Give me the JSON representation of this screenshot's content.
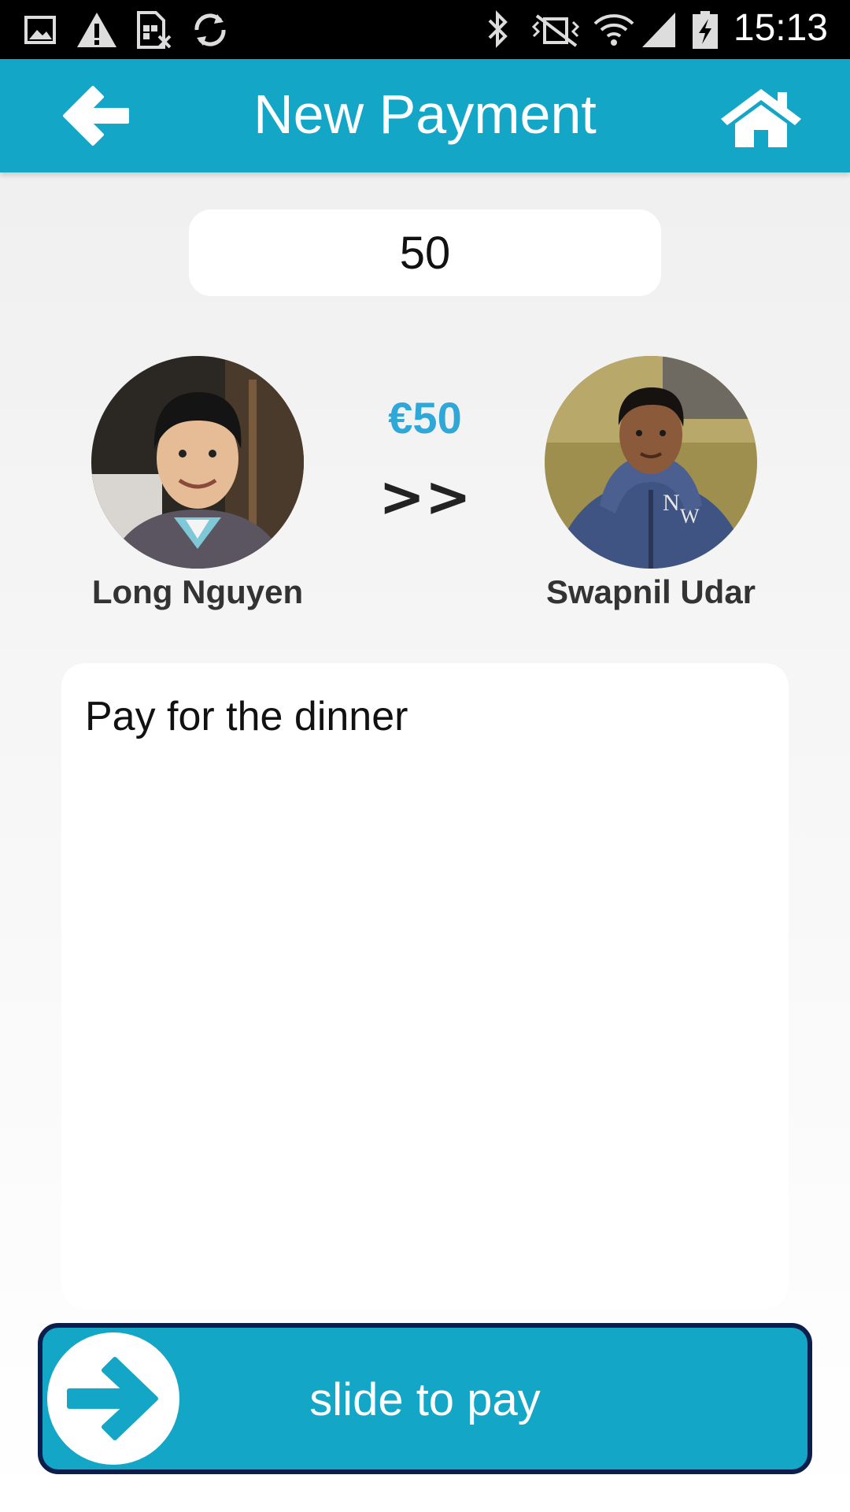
{
  "status_bar": {
    "time": "15:13",
    "left_icons": [
      "image-icon",
      "warning-icon",
      "sim-off-icon",
      "sync-icon"
    ],
    "right_icons": [
      "bluetooth-icon",
      "vibrate-icon",
      "wifi-icon",
      "signal-icon",
      "battery-charging-icon"
    ]
  },
  "header": {
    "title": "New Payment",
    "background": "#14a6c6"
  },
  "amount": {
    "value": "50"
  },
  "payer": {
    "name": "Long Nguyen"
  },
  "payee": {
    "name": "Swapnil Udar"
  },
  "transfer": {
    "amount": "€50",
    "arrow": ">>",
    "accent": "#2fa8d8"
  },
  "note": {
    "value": "Pay for the dinner"
  },
  "slider": {
    "label": "slide to pay",
    "border_color": "#0b1e4c"
  }
}
